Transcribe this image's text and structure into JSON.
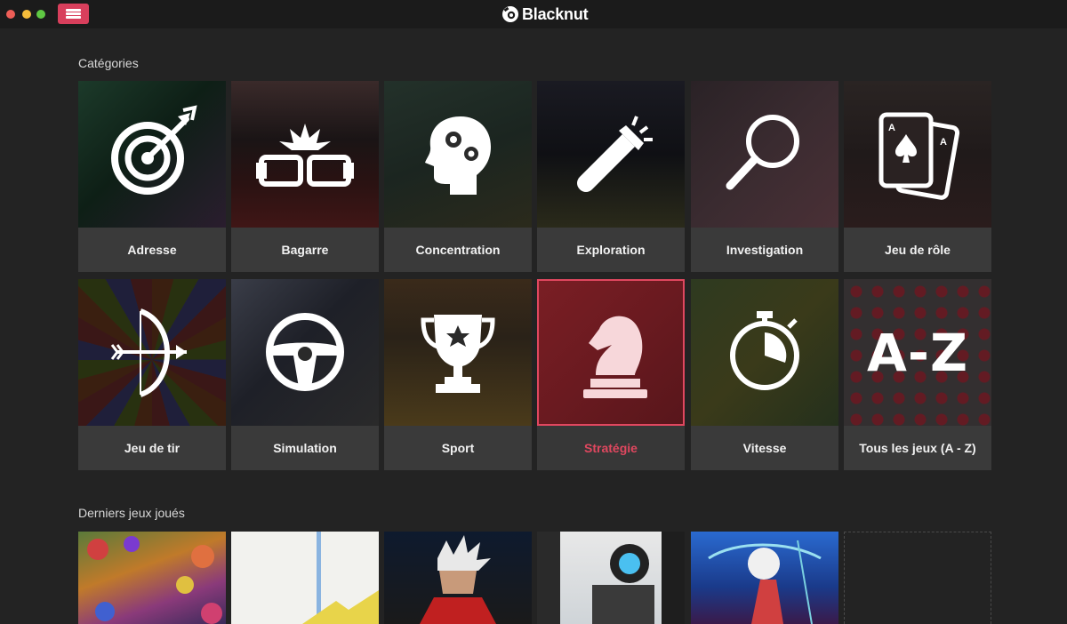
{
  "app": {
    "title": "Blacknut"
  },
  "sections": {
    "categories_title": "Catégories",
    "recent_title": "Derniers jeux joués"
  },
  "categories": [
    {
      "label": "Adresse",
      "icon": "target-icon"
    },
    {
      "label": "Bagarre",
      "icon": "fists-icon"
    },
    {
      "label": "Concentration",
      "icon": "brain-gears-icon"
    },
    {
      "label": "Exploration",
      "icon": "flashlight-icon"
    },
    {
      "label": "Investigation",
      "icon": "magnifier-icon"
    },
    {
      "label": "Jeu de rôle",
      "icon": "cards-icon"
    },
    {
      "label": "Jeu de tir",
      "icon": "bow-arrow-icon"
    },
    {
      "label": "Simulation",
      "icon": "steering-wheel-icon"
    },
    {
      "label": "Sport",
      "icon": "trophy-icon"
    },
    {
      "label": "Stratégie",
      "icon": "chess-knight-icon",
      "selected": true
    },
    {
      "label": "Vitesse",
      "icon": "stopwatch-icon"
    },
    {
      "label": "Tous les jeux (A - Z)",
      "icon": "a-z-icon",
      "icon_text": "A-Z"
    }
  ],
  "colors": {
    "accent": "#d83f5c",
    "selected_text": "#e0475f",
    "background": "#232323",
    "tile_label_bg": "#3a3a3a"
  }
}
